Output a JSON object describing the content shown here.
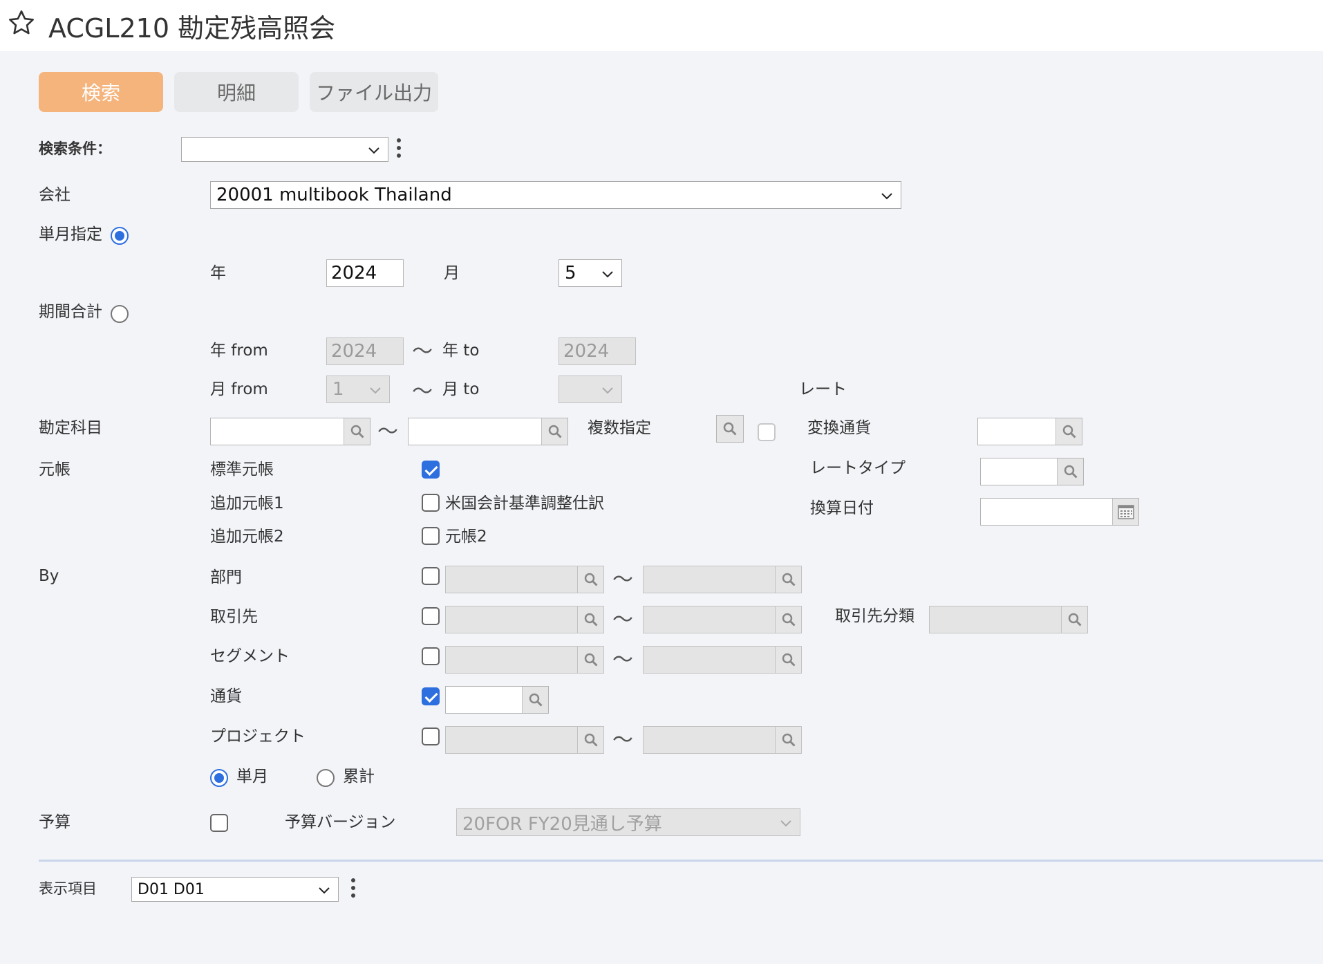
{
  "header": {
    "title": "ACGL210 勘定残高照会"
  },
  "toolbar": {
    "search": "検索",
    "detail": "明細",
    "file_output": "ファイル出力"
  },
  "search_condition": {
    "label": "検索条件：",
    "value": ""
  },
  "company": {
    "label": "会社",
    "value": "20001 multibook Thailand"
  },
  "single_month": {
    "label": "単月指定",
    "year_label": "年",
    "year": "2024",
    "month_label": "月",
    "month": "5"
  },
  "period_total": {
    "label": "期間合計",
    "year_from_label": "年 from",
    "year_from": "2024",
    "year_to_label": "年 to",
    "year_to": "2024",
    "month_from_label": "月 from",
    "month_from": "1",
    "month_to_label": "月 to",
    "month_to": "",
    "tilde": "〜"
  },
  "account": {
    "label": "勘定科目",
    "multi_label": "複数指定"
  },
  "rate": {
    "header": "レート",
    "conversion_currency": "変換通貨",
    "rate_type": "レートタイプ",
    "conversion_date": "換算日付"
  },
  "ledger": {
    "label": "元帳",
    "standard": "標準元帳",
    "additional1": "追加元帳1",
    "additional2": "追加元帳2",
    "us_gaap": "米国会計基準調整仕訳",
    "ledger2": "元帳2"
  },
  "by": {
    "label": "By",
    "department": "部門",
    "partner": "取引先",
    "partner_class": "取引先分類",
    "segment": "セグメント",
    "currency": "通貨",
    "project": "プロジェクト",
    "single_month": "単月",
    "cumulative": "累計"
  },
  "budget": {
    "label": "予算",
    "version_label": "予算バージョン",
    "version": "20FOR FY20見通し予算"
  },
  "display": {
    "label": "表示項目",
    "value": "D01 D01"
  }
}
